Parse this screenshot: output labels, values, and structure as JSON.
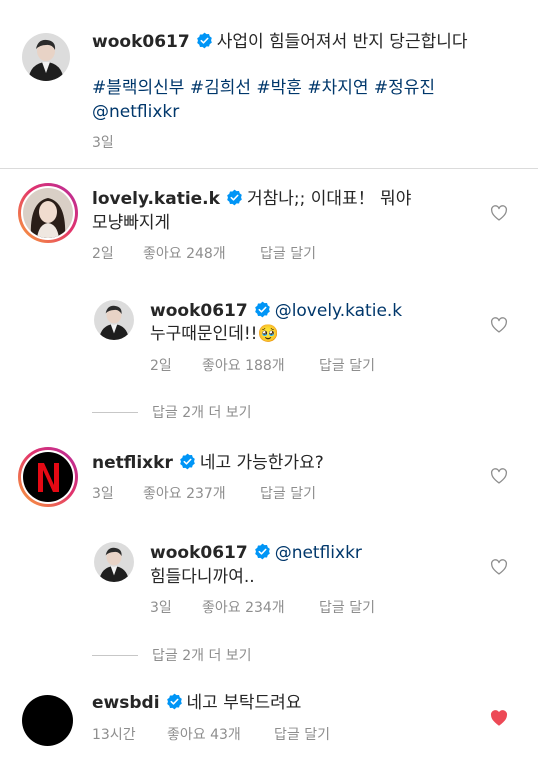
{
  "caption": {
    "username": "wook0617",
    "text": "사업이 힘들어져서 반지 당근합니다",
    "hashtags": "#블랙의신부 #김희선 #박훈 #차지연 #정유진",
    "mention": "@netflixkr",
    "time": "3일"
  },
  "comments": [
    {
      "username": "lovely.katie.k",
      "text_line1": "거참나;; 이대표！ 뭐야",
      "text_line2": "모냥빠지게",
      "time": "2일",
      "likes": "좋아요 248개",
      "reply": "답글 달기",
      "replies": [
        {
          "username": "wook0617",
          "mention": "@lovely.katie.k",
          "text": "누구때문인데!!🥹",
          "time": "2일",
          "likes": "좋아요 188개",
          "reply": "답글 달기"
        }
      ],
      "view_more": "답글 2개 더 보기"
    },
    {
      "username": "netflixkr",
      "text": "네고 가능한가요?",
      "time": "3일",
      "likes": "좋아요 237개",
      "reply": "답글 달기",
      "replies": [
        {
          "username": "wook0617",
          "mention": "@netflixkr",
          "text": "힘들다니까여..",
          "time": "3일",
          "likes": "좋아요 234개",
          "reply": "답글 달기"
        }
      ],
      "view_more": "답글 2개 더 보기"
    },
    {
      "username": "ewsbdi",
      "text": "네고 부탁드려요",
      "time": "13시간",
      "likes": "좋아요 43개",
      "reply": "답글 달기",
      "liked": true
    }
  ],
  "colors": {
    "verified": "#0095f6",
    "liked_heart": "#ed4956",
    "netflix_red": "#e50914",
    "link": "#00376b",
    "meta": "#8e8e8e"
  },
  "icons": [
    "verified-badge-icon",
    "heart-outline-icon",
    "heart-filled-icon",
    "netflix-logo-icon"
  ]
}
